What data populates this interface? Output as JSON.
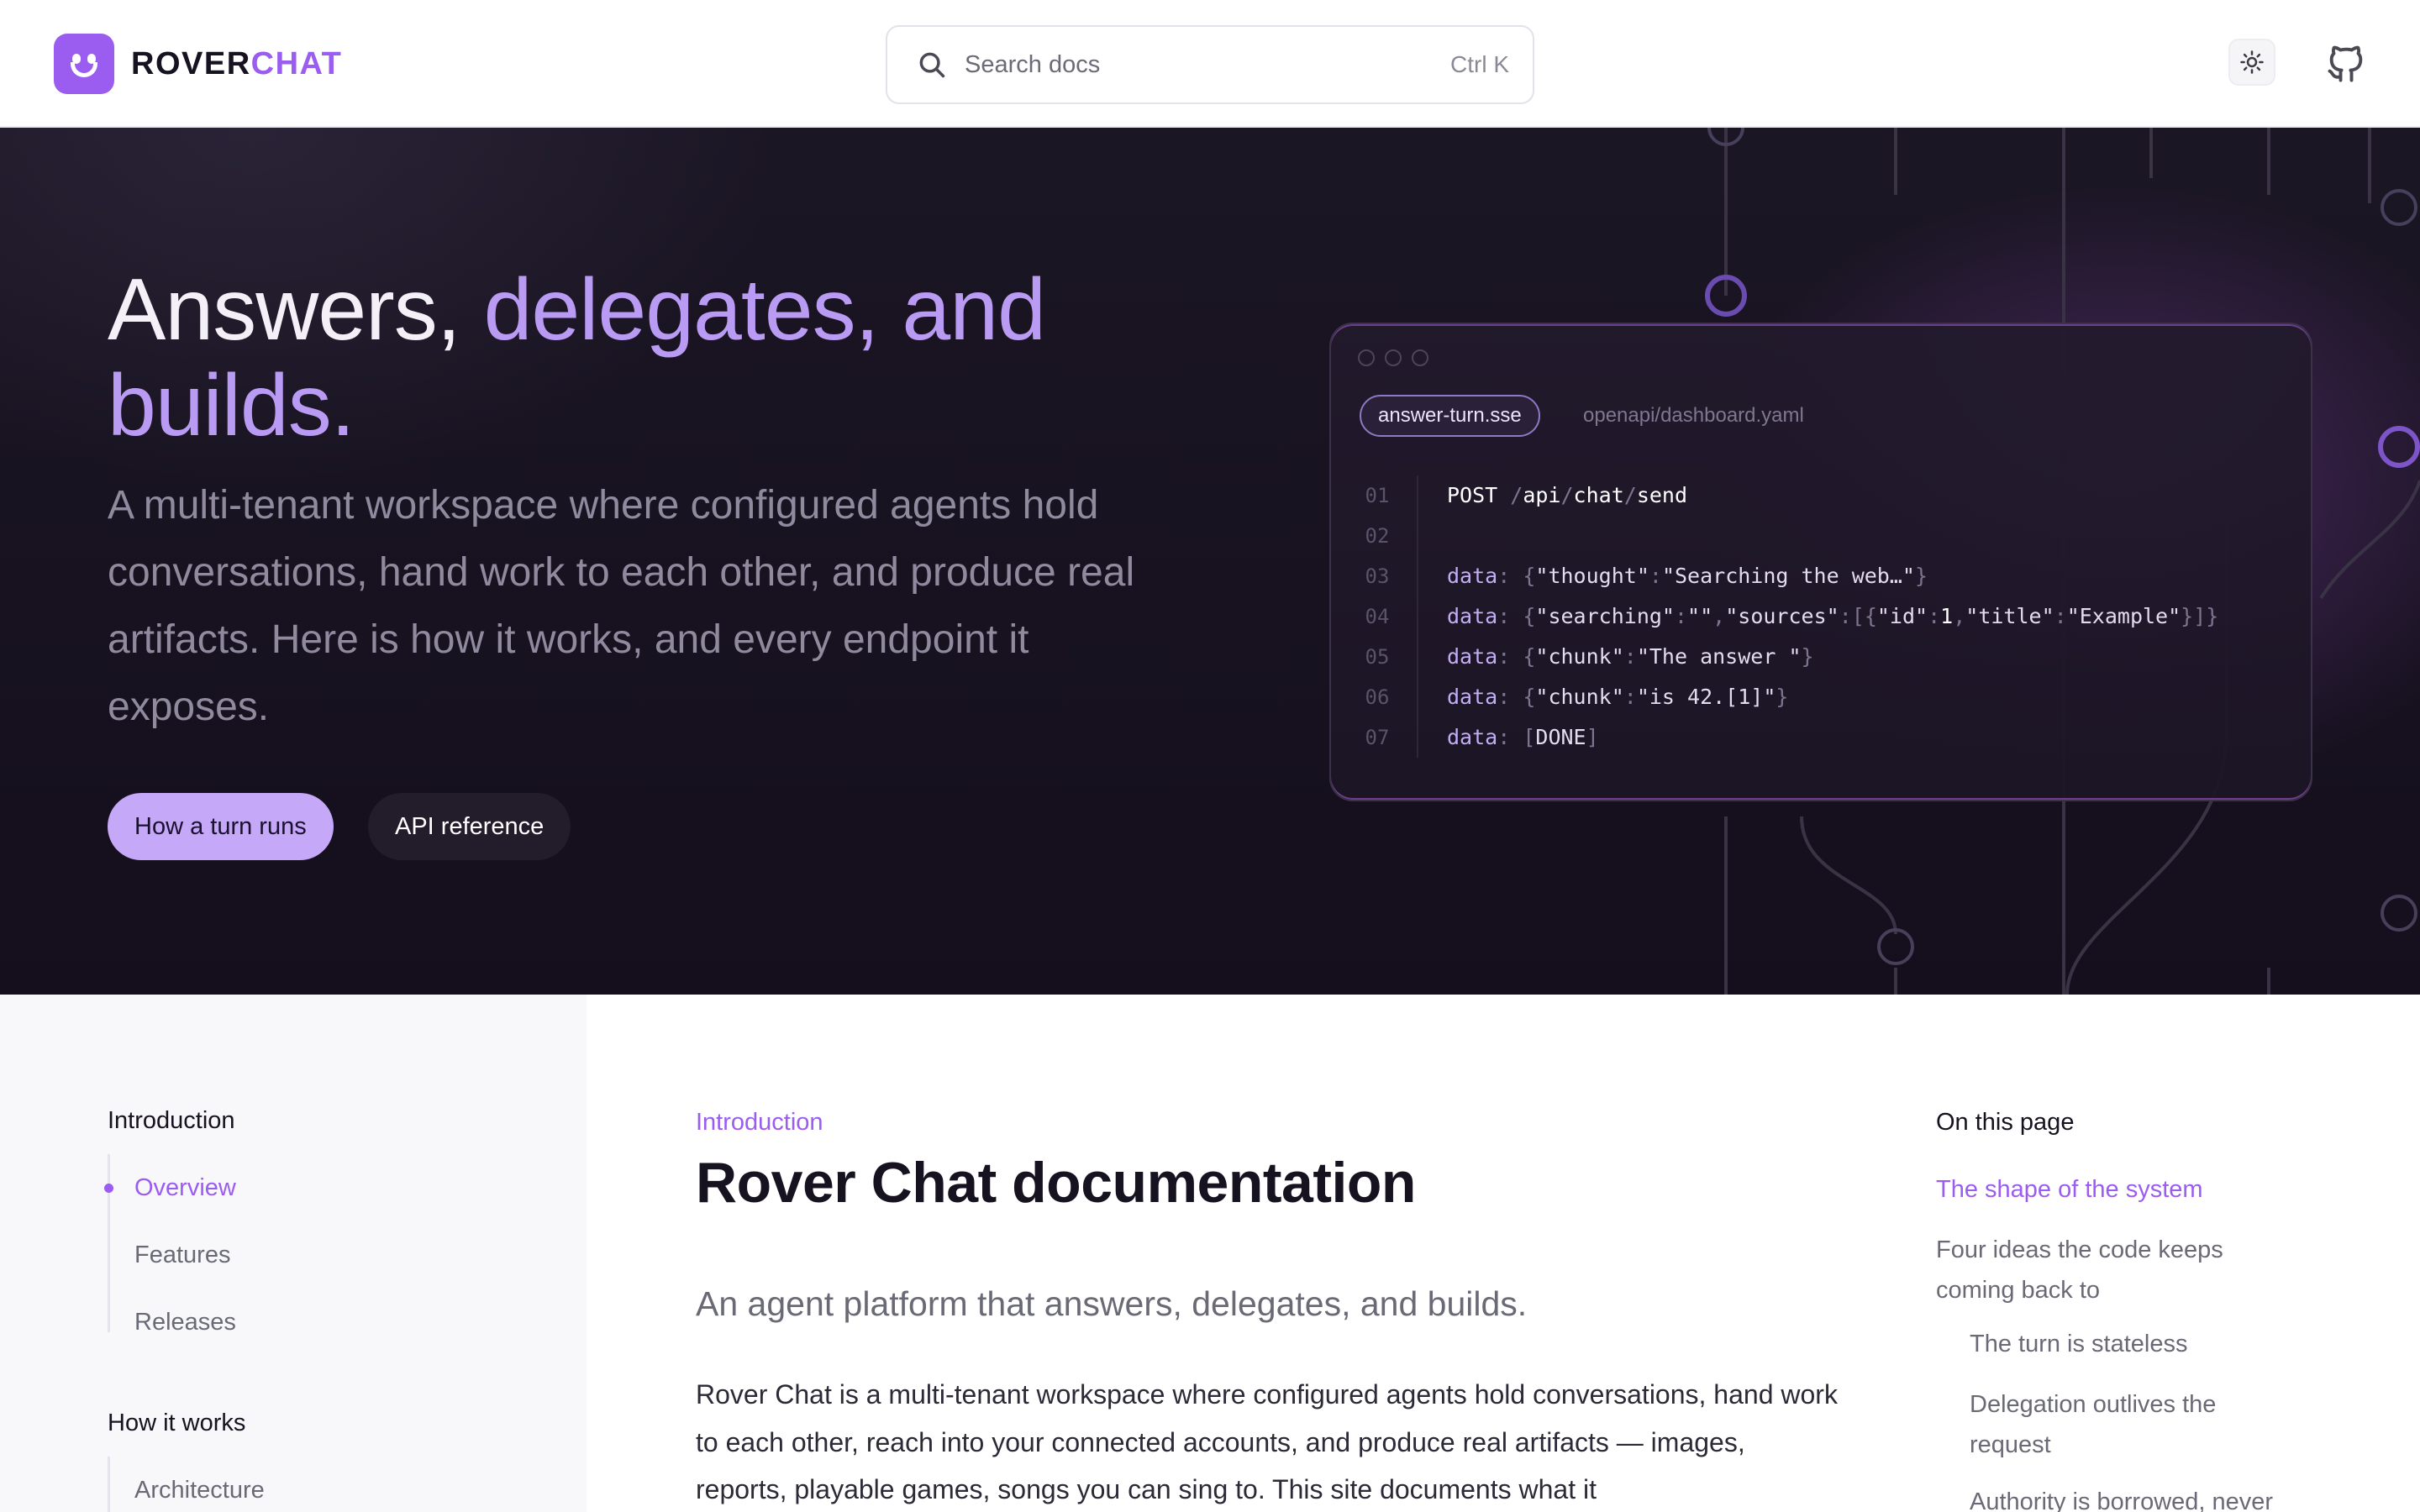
{
  "header": {
    "logo_text_a": "ROVER",
    "logo_text_b": "CHAT",
    "search_placeholder": "Search docs",
    "search_shortcut": "Ctrl K",
    "theme_icon": "sun-icon",
    "github_icon": "github-icon"
  },
  "hero": {
    "title_part1": "Answers, ",
    "title_accent": "delegates, and builds.",
    "subtitle": "A multi-tenant workspace where configured agents hold conversations, hand work to each other, and produce real artifacts. Here is how it works, and every endpoint it exposes.",
    "primary_button": "How a turn runs",
    "secondary_button": "API reference",
    "code": {
      "tab_active": "answer-turn.sse",
      "tab_inactive": "openapi/dashboard.yaml",
      "line_numbers": [
        "01",
        "02",
        "03",
        "04",
        "05",
        "06",
        "07"
      ],
      "lines": [
        "POST /api/chat/send",
        "",
        "data: {\"thought\":\"Searching the web…\"}",
        "data: {\"searching\":\"\",\"sources\":[{\"id\":1,\"title\":\"Example\"}]}",
        "data: {\"chunk\":\"The answer \"}",
        "data: {\"chunk\":\"is 42.[1]\"}",
        "data: [DONE]"
      ]
    }
  },
  "sidebar": {
    "groups": [
      {
        "title": "Introduction",
        "items": [
          "Overview",
          "Features",
          "Releases"
        ],
        "active": "Overview"
      },
      {
        "title": "How it works",
        "items": [
          "Architecture"
        ]
      }
    ]
  },
  "content": {
    "eyebrow": "Introduction",
    "title": "Rover Chat documentation",
    "lead": "An agent platform that answers, delegates, and builds.",
    "body": "Rover Chat is a multi-tenant workspace where configured agents hold conversations, hand work to each other, reach into your connected accounts, and produce real artifacts — images, reports, playable games, songs you can sing to. This site documents what it"
  },
  "toc": {
    "title": "On this page",
    "items": [
      "The shape of the system",
      "Four ideas the code keeps coming back to",
      "The turn is stateless",
      "Delegation outlives the request",
      "Authority is borrowed, never"
    ]
  },
  "colors": {
    "accent": "#9b5cf0",
    "accent_light": "#c5a8f7",
    "hero_bg": "#17111f"
  }
}
